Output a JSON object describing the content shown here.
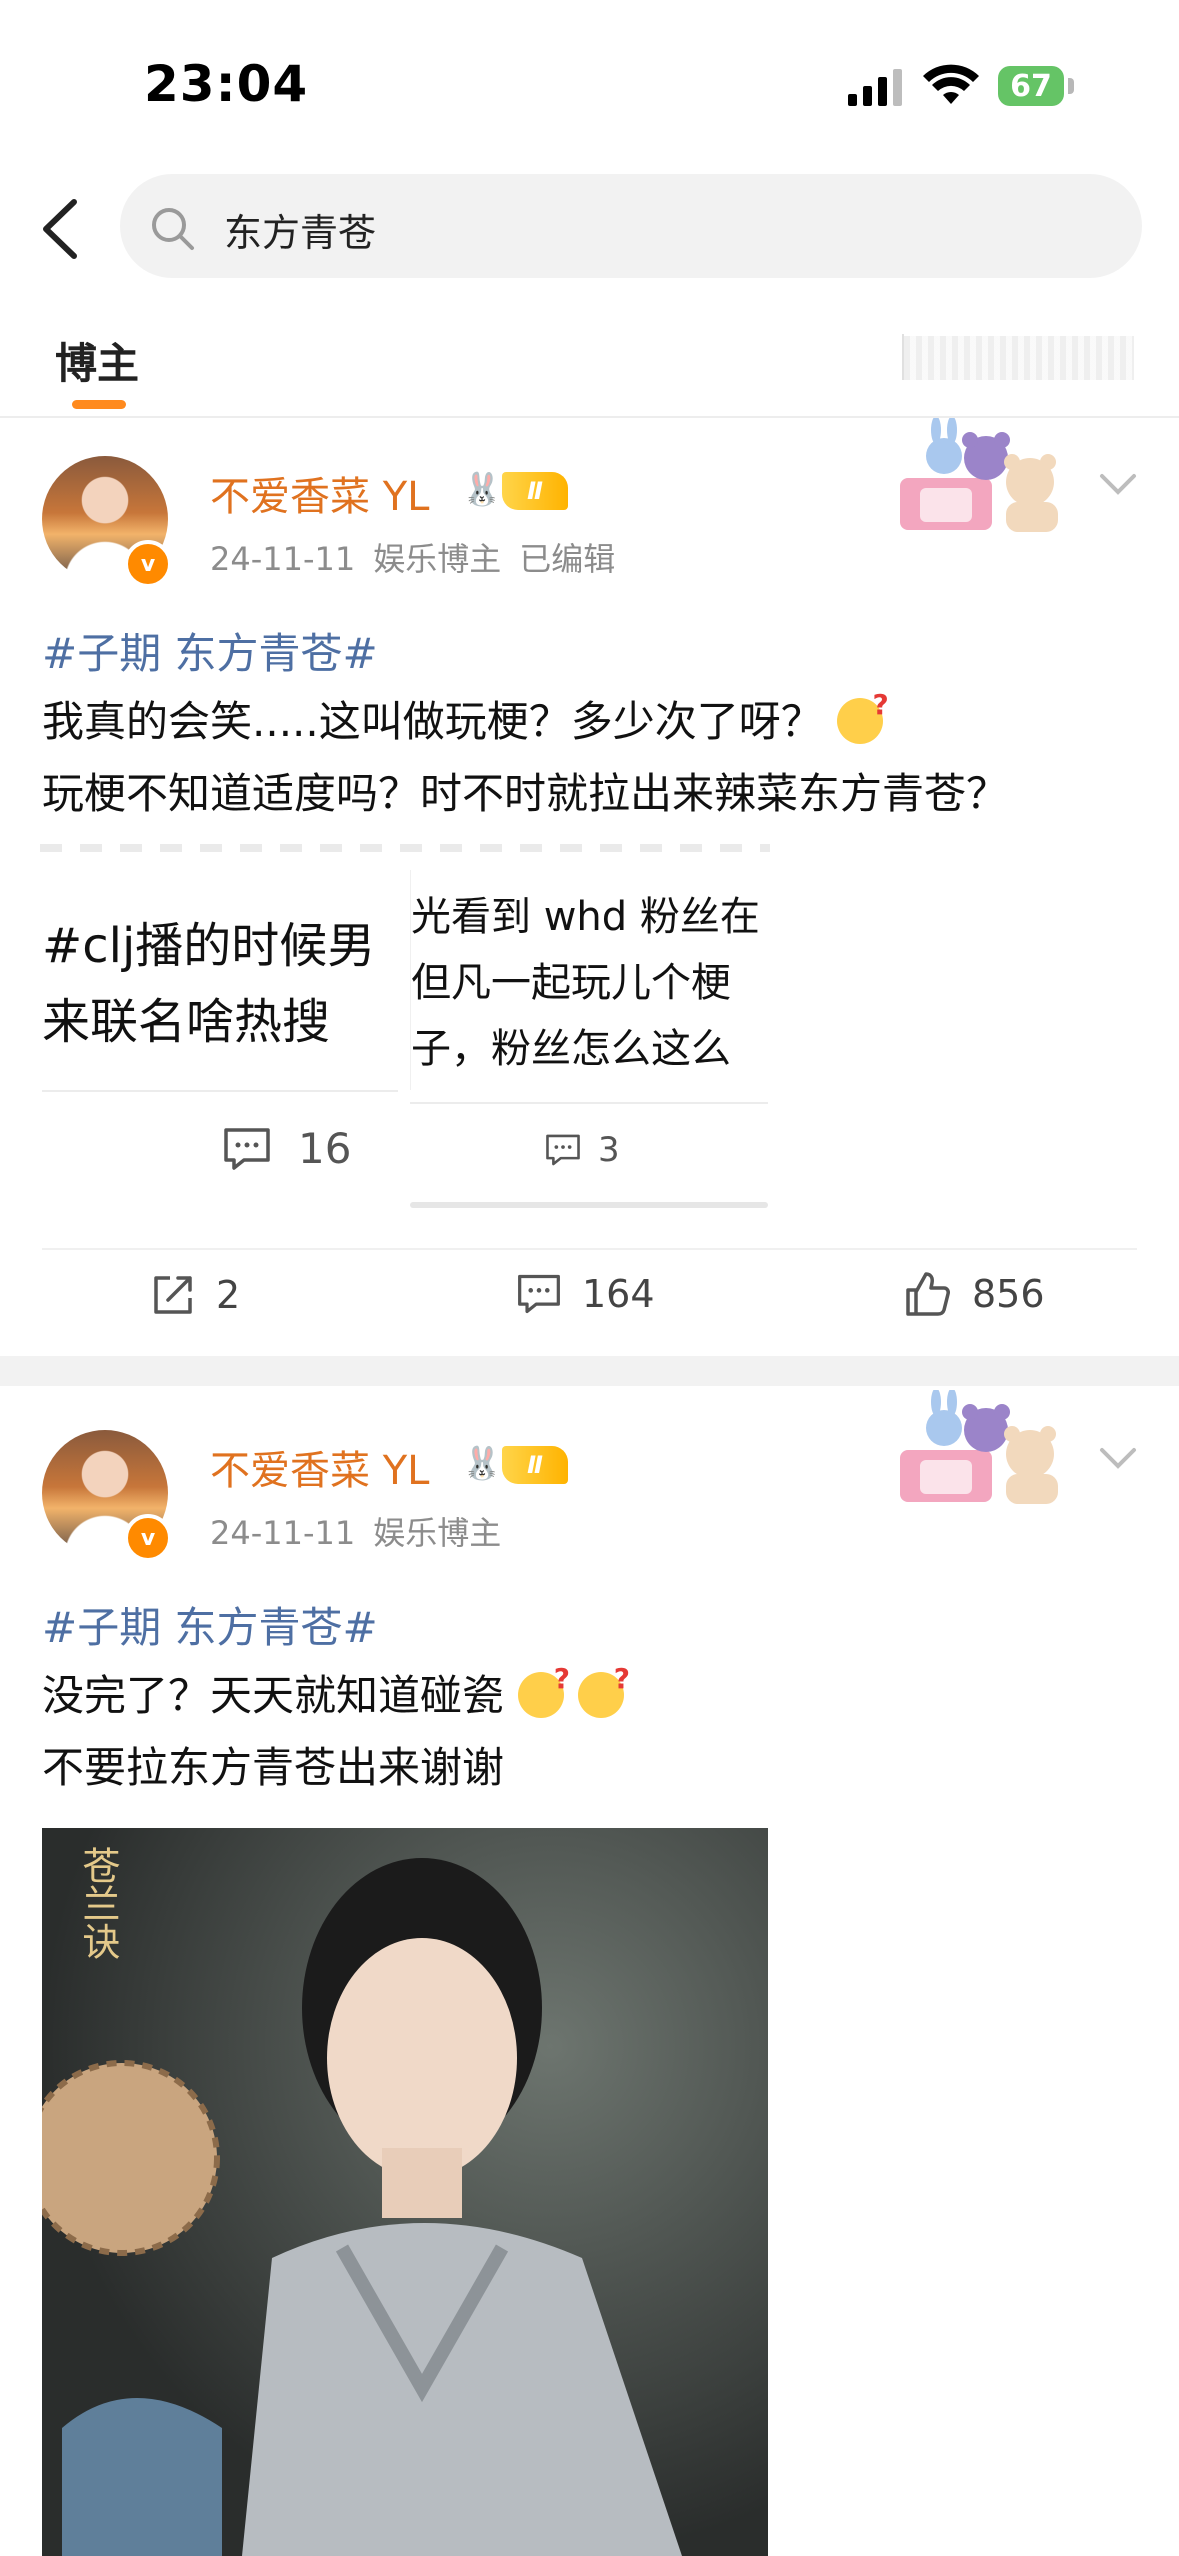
{
  "status_bar": {
    "time": "23:04",
    "battery": "67"
  },
  "search": {
    "query": "东方青苍"
  },
  "tabs": [
    {
      "label": "博主"
    }
  ],
  "posts": [
    {
      "user": {
        "name": "不爱香菜 YL",
        "level": "Ⅱ",
        "verified_mark": "v"
      },
      "meta": {
        "date": "24-11-11",
        "category": "娱乐博主",
        "edited": "已编辑"
      },
      "topic": "#子期 东方青苍#",
      "lines": [
        "我真的会笑.....这叫做玩梗？多少次了呀？",
        "玩梗不知道适度吗？时不时就拉出来辣菜东方青苍？"
      ],
      "embeds": [
        {
          "line1": "#clj播的时候男",
          "line2": "来联名啥热搜",
          "comments": "16"
        },
        {
          "line1": "光看到 whd 粉丝在",
          "line2": "但凡一起玩儿个梗",
          "line3": "子，粉丝怎么这么",
          "comments": "3"
        }
      ],
      "actions": {
        "share": "2",
        "comments": "164",
        "likes": "856"
      }
    },
    {
      "user": {
        "name": "不爱香菜 YL",
        "level": "Ⅱ",
        "verified_mark": "v"
      },
      "meta": {
        "date": "24-11-11",
        "category": "娱乐博主"
      },
      "topic": "#子期 东方青苍#",
      "lines": [
        "没完了？天天就知道碰瓷",
        "不要拉东方青苍出来谢谢"
      ],
      "image": {
        "watermark": "苍兰诀"
      }
    }
  ],
  "colors": {
    "accent": "#ff8a1e",
    "username": "#e0721f",
    "topic": "#4e6fa3"
  }
}
